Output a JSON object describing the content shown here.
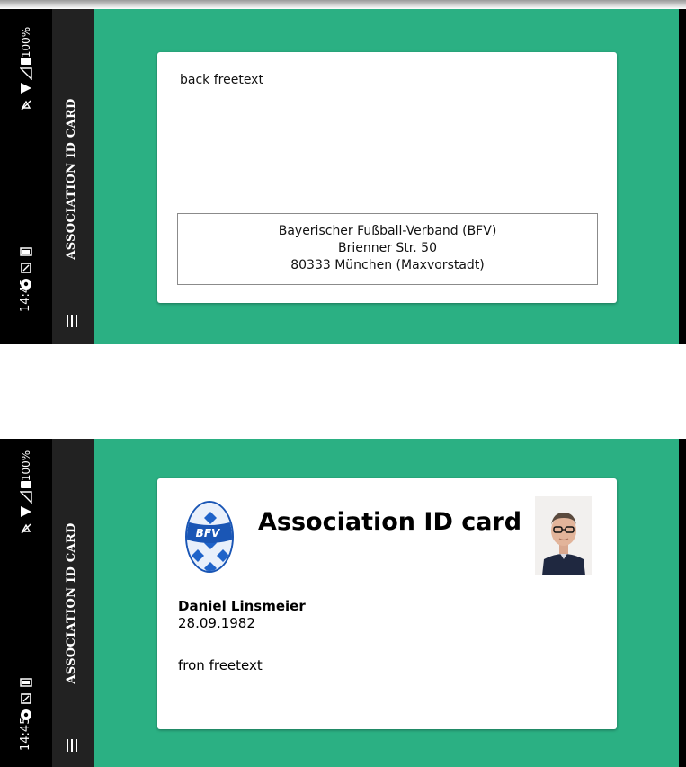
{
  "colors": {
    "accent": "#2bb083",
    "status_bar": "#000000",
    "app_bar": "#222222",
    "card": "#ffffff"
  },
  "status_bar": {
    "time": "14:45",
    "battery": "100%",
    "icons": [
      "notification-dot-icon",
      "screenshot-icon",
      "battery-saver-icon",
      "mute-icon",
      "wifi-icon",
      "signal-icon",
      "battery-icon"
    ]
  },
  "app_bar": {
    "title": "ASSOCIATION ID CARD",
    "menu_icon": "menu-icon"
  },
  "back_card": {
    "freetext": "back freetext",
    "address": [
      "Bayerischer Fußball-Verband (BFV)",
      "Brienner Str. 50",
      "80333 München (Maxvorstadt)"
    ]
  },
  "front_card": {
    "logo_text": "BFV",
    "title": "Association ID card",
    "member_name": "Daniel Linsmeier",
    "birth_date": "28.09.1982",
    "freetext": "fron freetext"
  }
}
